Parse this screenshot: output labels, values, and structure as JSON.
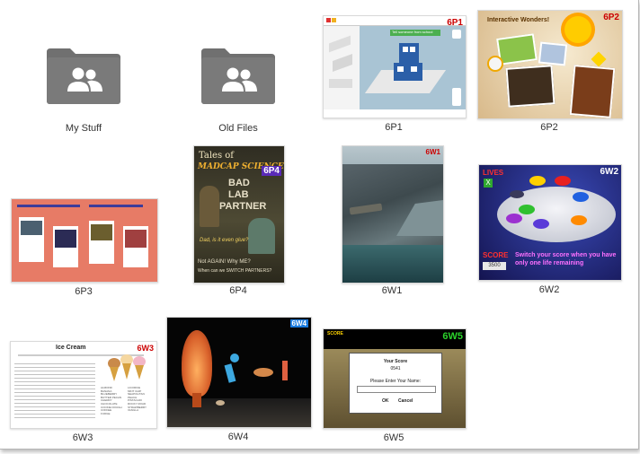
{
  "folders": [
    {
      "label": "My Stuff"
    },
    {
      "label": "Old Files"
    }
  ],
  "files": [
    {
      "label": "6P1",
      "badge": "6P1",
      "toolbar_text": "Tell someone from school"
    },
    {
      "label": "6P2",
      "badge": "6P2",
      "heading": "Interactive Wonders!"
    },
    {
      "label": "6P3"
    },
    {
      "label": "6P4",
      "badge": "6P4",
      "line1": "Tales of",
      "line2": "MADCAP SCIENCE",
      "line3": "BAD",
      "line4": "LAB",
      "line5": "PARTNER",
      "line6": "Dad, is it even glue?",
      "line7": "Not AGAIN! Why ME?",
      "line8": "When can we SWITCH PARTNERS?"
    },
    {
      "label": "6W1",
      "badge": "6W1"
    },
    {
      "label": "6W2",
      "badge": "6W2",
      "lives": "LIVES",
      "lives_value": "X",
      "score_label": "SCORE",
      "score_value": "3500",
      "caption": "Switch your score when you have only one life remaining"
    },
    {
      "label": "6W3",
      "badge": "6W3",
      "title": "Ice Cream",
      "words": [
        "ALMOND",
        "BANANA",
        "BLUEBERRY",
        "BUTTER PECAN",
        "CHERRY",
        "CHOCOLATE",
        "COOKIE DOUGH",
        "COFFEE",
        "FUDGE",
        "LICORICE",
        "MINT CHIP",
        "NEAPOLITAN",
        "PEACH",
        "PISTACHIO",
        "ROCKY ROAD",
        "STRAWBERRY",
        "VANILLA"
      ]
    },
    {
      "label": "6W4",
      "badge": "6W4"
    },
    {
      "label": "6W5",
      "badge": "6W5",
      "score_top": "SCORE",
      "dialog_title": "Your Score",
      "dialog_score": "0541",
      "prompt": "Please Enter Your Name:",
      "ok": "OK",
      "cancel": "Cancel"
    }
  ],
  "colors": {
    "folder": "#6e6e6e",
    "badge_red": "#cc0000",
    "badge_blue": "#1a3acc"
  },
  "icons": {
    "folder": "shared-folder-icon"
  }
}
